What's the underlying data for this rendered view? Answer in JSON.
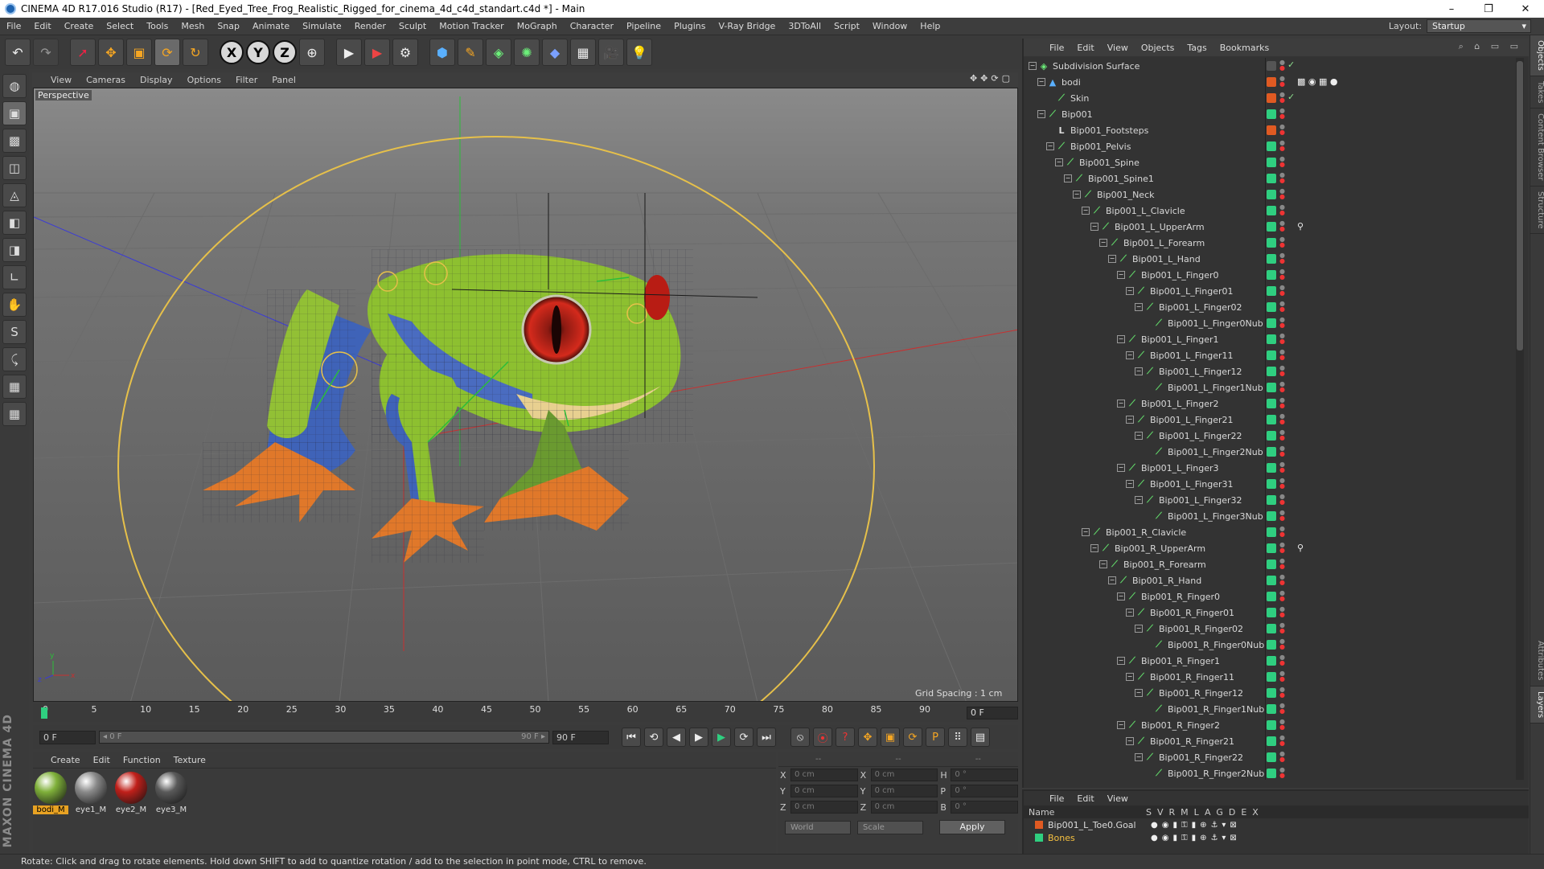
{
  "window": {
    "title": "CINEMA 4D R17.016 Studio (R17) - [Red_Eyed_Tree_Frog_Realistic_Rigged_for_cinema_4d_c4d_standart.c4d *] - Main",
    "minimize": "–",
    "maximize": "❐",
    "close": "✕"
  },
  "menu": [
    "File",
    "Edit",
    "Create",
    "Select",
    "Tools",
    "Mesh",
    "Snap",
    "Animate",
    "Simulate",
    "Render",
    "Sculpt",
    "Motion Tracker",
    "MoGraph",
    "Character",
    "Pipeline",
    "Plugins",
    "V-Ray Bridge",
    "3DToAll",
    "Script",
    "Window",
    "Help"
  ],
  "layout": {
    "label": "Layout:",
    "value": "Startup"
  },
  "toolbar": {
    "undo": "↶",
    "redo": "↷",
    "select": "➚",
    "move": "✥",
    "scale": "▣",
    "rotate": "⟳",
    "rotate2": "↻",
    "axis_x": "X",
    "axis_y": "Y",
    "axis_z": "Z",
    "world": "⊕",
    "render_view": "▶",
    "render_pv": "▶",
    "render_settings": "⚙",
    "cube": "⬢",
    "pen": "✎",
    "subdiv": "◈",
    "array": "✺",
    "deformer": "◆",
    "floor": "▦",
    "camera": "🎥",
    "light": "💡"
  },
  "left_tools": [
    "◍",
    "▣",
    "▩",
    "◫",
    "◬",
    "◧",
    "◨",
    "∟",
    "✋",
    "S",
    "⤹",
    "▦",
    "▦"
  ],
  "maxon_logo": "MAXON CINEMA 4D",
  "viewport": {
    "menu": [
      "View",
      "Cameras",
      "Display",
      "Options",
      "Filter",
      "Panel"
    ],
    "nav_icons": "✥✥⟳▢",
    "label": "Perspective",
    "grid_spacing": "Grid Spacing : 1 cm"
  },
  "timeline": {
    "ticks": [
      "0",
      "5",
      "10",
      "15",
      "20",
      "25",
      "30",
      "35",
      "40",
      "45",
      "50",
      "55",
      "60",
      "65",
      "70",
      "75",
      "80",
      "85",
      "90"
    ],
    "current_frame": "0 F"
  },
  "transport": {
    "start_field": "0 F",
    "slider_left": "◂ 0 F",
    "slider_right": "90 F ▸",
    "end_field": "90 F",
    "buttons": [
      "⏮",
      "⟲",
      "◀",
      "▶",
      "▶",
      "⟳",
      "⏭"
    ],
    "key_buttons": [
      "⦸",
      "⦿",
      "?",
      "✥",
      "▣",
      "⟳",
      "P",
      "⠿",
      "▤"
    ]
  },
  "materials": {
    "menu": [
      "Create",
      "Edit",
      "Function",
      "Texture"
    ],
    "items": [
      {
        "name": "bodi_M",
        "color": "#7fb03a",
        "selected": true
      },
      {
        "name": "eye1_M",
        "color": "#8a8a8a",
        "selected": false
      },
      {
        "name": "eye2_M",
        "color": "#c0201a",
        "selected": false
      },
      {
        "name": "eye3_M",
        "color": "#5a5a5a",
        "selected": false
      }
    ]
  },
  "coordinates": {
    "headers": [
      "--",
      "--",
      "--"
    ],
    "rows": [
      {
        "l1": "X",
        "v1": "0 cm",
        "l2": "X",
        "v2": "0 cm",
        "l3": "H",
        "v3": "0 °"
      },
      {
        "l1": "Y",
        "v1": "0 cm",
        "l2": "Y",
        "v2": "0 cm",
        "l3": "P",
        "v3": "0 °"
      },
      {
        "l1": "Z",
        "v1": "0 cm",
        "l2": "Z",
        "v2": "0 cm",
        "l3": "B",
        "v3": "0 °"
      }
    ],
    "mode": "World",
    "type": "Scale",
    "apply": "Apply"
  },
  "object_manager": {
    "menu": [
      "File",
      "Edit",
      "View",
      "Objects",
      "Tags",
      "Bookmarks"
    ],
    "icons": "⌕ ⌂ ▭ ▭",
    "objects": [
      {
        "name": "Subdivision Surface",
        "depth": 0,
        "exp": "−",
        "icon": "◈",
        "layer": "#555",
        "check": "✓",
        "tags": ""
      },
      {
        "name": "bodi",
        "depth": 1,
        "exp": "−",
        "icon": "▲",
        "layer": "#e05a22",
        "check": "",
        "tags": "▩ ◉ ▦ ●"
      },
      {
        "name": "Skin",
        "depth": 2,
        "exp": "",
        "icon": "⟋",
        "layer": "#e05a22",
        "check": "✓",
        "tags": ""
      },
      {
        "name": "Bip001",
        "depth": 1,
        "exp": "−",
        "icon": "⟋",
        "layer": "#2fcf80",
        "check": "",
        "tags": ""
      },
      {
        "name": "Bip001_Footsteps",
        "depth": 2,
        "exp": "",
        "icon": "L",
        "layer": "#e05a22",
        "check": "",
        "tags": ""
      },
      {
        "name": "Bip001_Pelvis",
        "depth": 2,
        "exp": "−",
        "icon": "⟋",
        "layer": "#2fcf80",
        "check": "",
        "tags": ""
      },
      {
        "name": "Bip001_Spine",
        "depth": 3,
        "exp": "−",
        "icon": "⟋",
        "layer": "#2fcf80",
        "check": "",
        "tags": ""
      },
      {
        "name": "Bip001_Spine1",
        "depth": 4,
        "exp": "−",
        "icon": "⟋",
        "layer": "#2fcf80",
        "check": "",
        "tags": ""
      },
      {
        "name": "Bip001_Neck",
        "depth": 5,
        "exp": "−",
        "icon": "⟋",
        "layer": "#2fcf80",
        "check": "",
        "tags": ""
      },
      {
        "name": "Bip001_L_Clavicle",
        "depth": 6,
        "exp": "−",
        "icon": "⟋",
        "layer": "#2fcf80",
        "check": "",
        "tags": ""
      },
      {
        "name": "Bip001_L_UpperArm",
        "depth": 7,
        "exp": "−",
        "icon": "⟋",
        "layer": "#2fcf80",
        "check": "",
        "tags": "⚲"
      },
      {
        "name": "Bip001_L_Forearm",
        "depth": 8,
        "exp": "−",
        "icon": "⟋",
        "layer": "#2fcf80",
        "check": "",
        "tags": ""
      },
      {
        "name": "Bip001_L_Hand",
        "depth": 9,
        "exp": "−",
        "icon": "⟋",
        "layer": "#2fcf80",
        "check": "",
        "tags": ""
      },
      {
        "name": "Bip001_L_Finger0",
        "depth": 10,
        "exp": "−",
        "icon": "⟋",
        "layer": "#2fcf80",
        "check": "",
        "tags": ""
      },
      {
        "name": "Bip001_L_Finger01",
        "depth": 11,
        "exp": "−",
        "icon": "⟋",
        "layer": "#2fcf80",
        "check": "",
        "tags": ""
      },
      {
        "name": "Bip001_L_Finger02",
        "depth": 12,
        "exp": "−",
        "icon": "⟋",
        "layer": "#2fcf80",
        "check": "",
        "tags": ""
      },
      {
        "name": "Bip001_L_Finger0Nub",
        "depth": 13,
        "exp": "",
        "icon": "⟋",
        "layer": "#2fcf80",
        "check": "",
        "tags": ""
      },
      {
        "name": "Bip001_L_Finger1",
        "depth": 10,
        "exp": "−",
        "icon": "⟋",
        "layer": "#2fcf80",
        "check": "",
        "tags": ""
      },
      {
        "name": "Bip001_L_Finger11",
        "depth": 11,
        "exp": "−",
        "icon": "⟋",
        "layer": "#2fcf80",
        "check": "",
        "tags": ""
      },
      {
        "name": "Bip001_L_Finger12",
        "depth": 12,
        "exp": "−",
        "icon": "⟋",
        "layer": "#2fcf80",
        "check": "",
        "tags": ""
      },
      {
        "name": "Bip001_L_Finger1Nub",
        "depth": 13,
        "exp": "",
        "icon": "⟋",
        "layer": "#2fcf80",
        "check": "",
        "tags": ""
      },
      {
        "name": "Bip001_L_Finger2",
        "depth": 10,
        "exp": "−",
        "icon": "⟋",
        "layer": "#2fcf80",
        "check": "",
        "tags": ""
      },
      {
        "name": "Bip001_L_Finger21",
        "depth": 11,
        "exp": "−",
        "icon": "⟋",
        "layer": "#2fcf80",
        "check": "",
        "tags": ""
      },
      {
        "name": "Bip001_L_Finger22",
        "depth": 12,
        "exp": "−",
        "icon": "⟋",
        "layer": "#2fcf80",
        "check": "",
        "tags": ""
      },
      {
        "name": "Bip001_L_Finger2Nub",
        "depth": 13,
        "exp": "",
        "icon": "⟋",
        "layer": "#2fcf80",
        "check": "",
        "tags": ""
      },
      {
        "name": "Bip001_L_Finger3",
        "depth": 10,
        "exp": "−",
        "icon": "⟋",
        "layer": "#2fcf80",
        "check": "",
        "tags": ""
      },
      {
        "name": "Bip001_L_Finger31",
        "depth": 11,
        "exp": "−",
        "icon": "⟋",
        "layer": "#2fcf80",
        "check": "",
        "tags": ""
      },
      {
        "name": "Bip001_L_Finger32",
        "depth": 12,
        "exp": "−",
        "icon": "⟋",
        "layer": "#2fcf80",
        "check": "",
        "tags": ""
      },
      {
        "name": "Bip001_L_Finger3Nub",
        "depth": 13,
        "exp": "",
        "icon": "⟋",
        "layer": "#2fcf80",
        "check": "",
        "tags": ""
      },
      {
        "name": "Bip001_R_Clavicle",
        "depth": 6,
        "exp": "−",
        "icon": "⟋",
        "layer": "#2fcf80",
        "check": "",
        "tags": ""
      },
      {
        "name": "Bip001_R_UpperArm",
        "depth": 7,
        "exp": "−",
        "icon": "⟋",
        "layer": "#2fcf80",
        "check": "",
        "tags": "⚲"
      },
      {
        "name": "Bip001_R_Forearm",
        "depth": 8,
        "exp": "−",
        "icon": "⟋",
        "layer": "#2fcf80",
        "check": "",
        "tags": ""
      },
      {
        "name": "Bip001_R_Hand",
        "depth": 9,
        "exp": "−",
        "icon": "⟋",
        "layer": "#2fcf80",
        "check": "",
        "tags": ""
      },
      {
        "name": "Bip001_R_Finger0",
        "depth": 10,
        "exp": "−",
        "icon": "⟋",
        "layer": "#2fcf80",
        "check": "",
        "tags": ""
      },
      {
        "name": "Bip001_R_Finger01",
        "depth": 11,
        "exp": "−",
        "icon": "⟋",
        "layer": "#2fcf80",
        "check": "",
        "tags": ""
      },
      {
        "name": "Bip001_R_Finger02",
        "depth": 12,
        "exp": "−",
        "icon": "⟋",
        "layer": "#2fcf80",
        "check": "",
        "tags": ""
      },
      {
        "name": "Bip001_R_Finger0Nub",
        "depth": 13,
        "exp": "",
        "icon": "⟋",
        "layer": "#2fcf80",
        "check": "",
        "tags": ""
      },
      {
        "name": "Bip001_R_Finger1",
        "depth": 10,
        "exp": "−",
        "icon": "⟋",
        "layer": "#2fcf80",
        "check": "",
        "tags": ""
      },
      {
        "name": "Bip001_R_Finger11",
        "depth": 11,
        "exp": "−",
        "icon": "⟋",
        "layer": "#2fcf80",
        "check": "",
        "tags": ""
      },
      {
        "name": "Bip001_R_Finger12",
        "depth": 12,
        "exp": "−",
        "icon": "⟋",
        "layer": "#2fcf80",
        "check": "",
        "tags": ""
      },
      {
        "name": "Bip001_R_Finger1Nub",
        "depth": 13,
        "exp": "",
        "icon": "⟋",
        "layer": "#2fcf80",
        "check": "",
        "tags": ""
      },
      {
        "name": "Bip001_R_Finger2",
        "depth": 10,
        "exp": "−",
        "icon": "⟋",
        "layer": "#2fcf80",
        "check": "",
        "tags": ""
      },
      {
        "name": "Bip001_R_Finger21",
        "depth": 11,
        "exp": "−",
        "icon": "⟋",
        "layer": "#2fcf80",
        "check": "",
        "tags": ""
      },
      {
        "name": "Bip001_R_Finger22",
        "depth": 12,
        "exp": "−",
        "icon": "⟋",
        "layer": "#2fcf80",
        "check": "",
        "tags": ""
      },
      {
        "name": "Bip001_R_Finger2Nub",
        "depth": 13,
        "exp": "",
        "icon": "⟋",
        "layer": "#2fcf80",
        "check": "",
        "tags": ""
      }
    ]
  },
  "layer_manager": {
    "menu": [
      "File",
      "Edit",
      "View"
    ],
    "header_name": "Name",
    "header_cols": "SVRMLAGDEX",
    "layers": [
      {
        "name": "Bip001_L_Toe0.Goal",
        "color": "#e05a22",
        "ctl": "●◉▮⚿▮⊕⚓▾⊠"
      },
      {
        "name": "Bones",
        "color": "#2fcf80",
        "ctl": "●◉▮⚿▮⊕⚓▾⊠"
      }
    ]
  },
  "right_tabs": [
    "Objects",
    "Takes",
    "Content Browser",
    "Structure",
    "Attributes",
    "Layers"
  ],
  "status": "Rotate: Click and drag to rotate elements. Hold down SHIFT to add to quantize rotation / add to the selection in point mode, CTRL to remove."
}
